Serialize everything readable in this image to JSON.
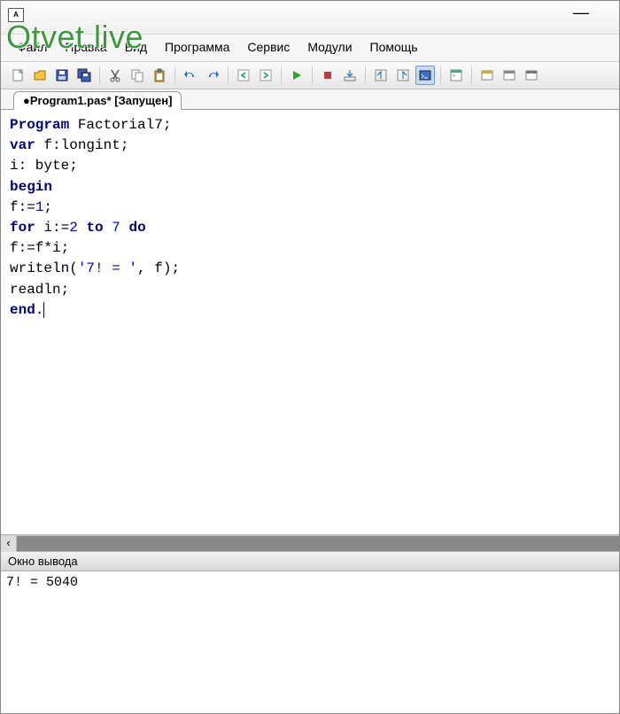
{
  "titlebar": {
    "app_icon_text": "A"
  },
  "watermark": "Otvet.live",
  "menu": {
    "file": "Файл",
    "edit": "Правка",
    "view": "Вид",
    "program": "Программа",
    "service": "Сервис",
    "modules": "Модули",
    "help": "Помощь"
  },
  "toolbar_icons": {
    "new": "new-file-icon",
    "open": "open-file-icon",
    "save": "save-icon",
    "save_all": "save-all-icon",
    "cut": "cut-icon",
    "copy": "copy-icon",
    "paste": "paste-icon",
    "undo": "undo-icon",
    "redo": "redo-icon",
    "nav_back": "nav-back-icon",
    "nav_fwd": "nav-fwd-icon",
    "run": "run-icon",
    "stop": "stop-icon",
    "step_into": "step-into-icon",
    "step_over": "step-over-icon",
    "step_out": "step-out-icon",
    "console": "console-icon",
    "form": "form-icon",
    "module1": "module-icon",
    "module2": "module-icon",
    "module3": "module-icon"
  },
  "tab": {
    "dirty_marker": "●",
    "filename": "Program1.pas*",
    "status": "[Запущен]"
  },
  "code": {
    "l1_kw": "Program",
    "l1_rest": " Factorial7;",
    "l2_kw": "var",
    "l2_rest": " f:longint;",
    "l3": "i: byte;",
    "l4_kw": "begin",
    "l5_a": "f:=",
    "l5_num": "1",
    "l5_b": ";",
    "l6_kw1": "for",
    "l6_a": " i:=",
    "l6_num1": "2",
    "l6_b": " ",
    "l6_kw2": "to",
    "l6_c": " ",
    "l6_num2": "7",
    "l6_d": " ",
    "l6_kw3": "do",
    "l7": "f:=f*i;",
    "l8_a": "writeln(",
    "l8_str": "'7! = '",
    "l8_b": ", f);",
    "l9": "readln;",
    "l10_kw": "end",
    "l10_rest": "."
  },
  "output": {
    "header": "Окно вывода",
    "line1": "7! = 5040"
  }
}
